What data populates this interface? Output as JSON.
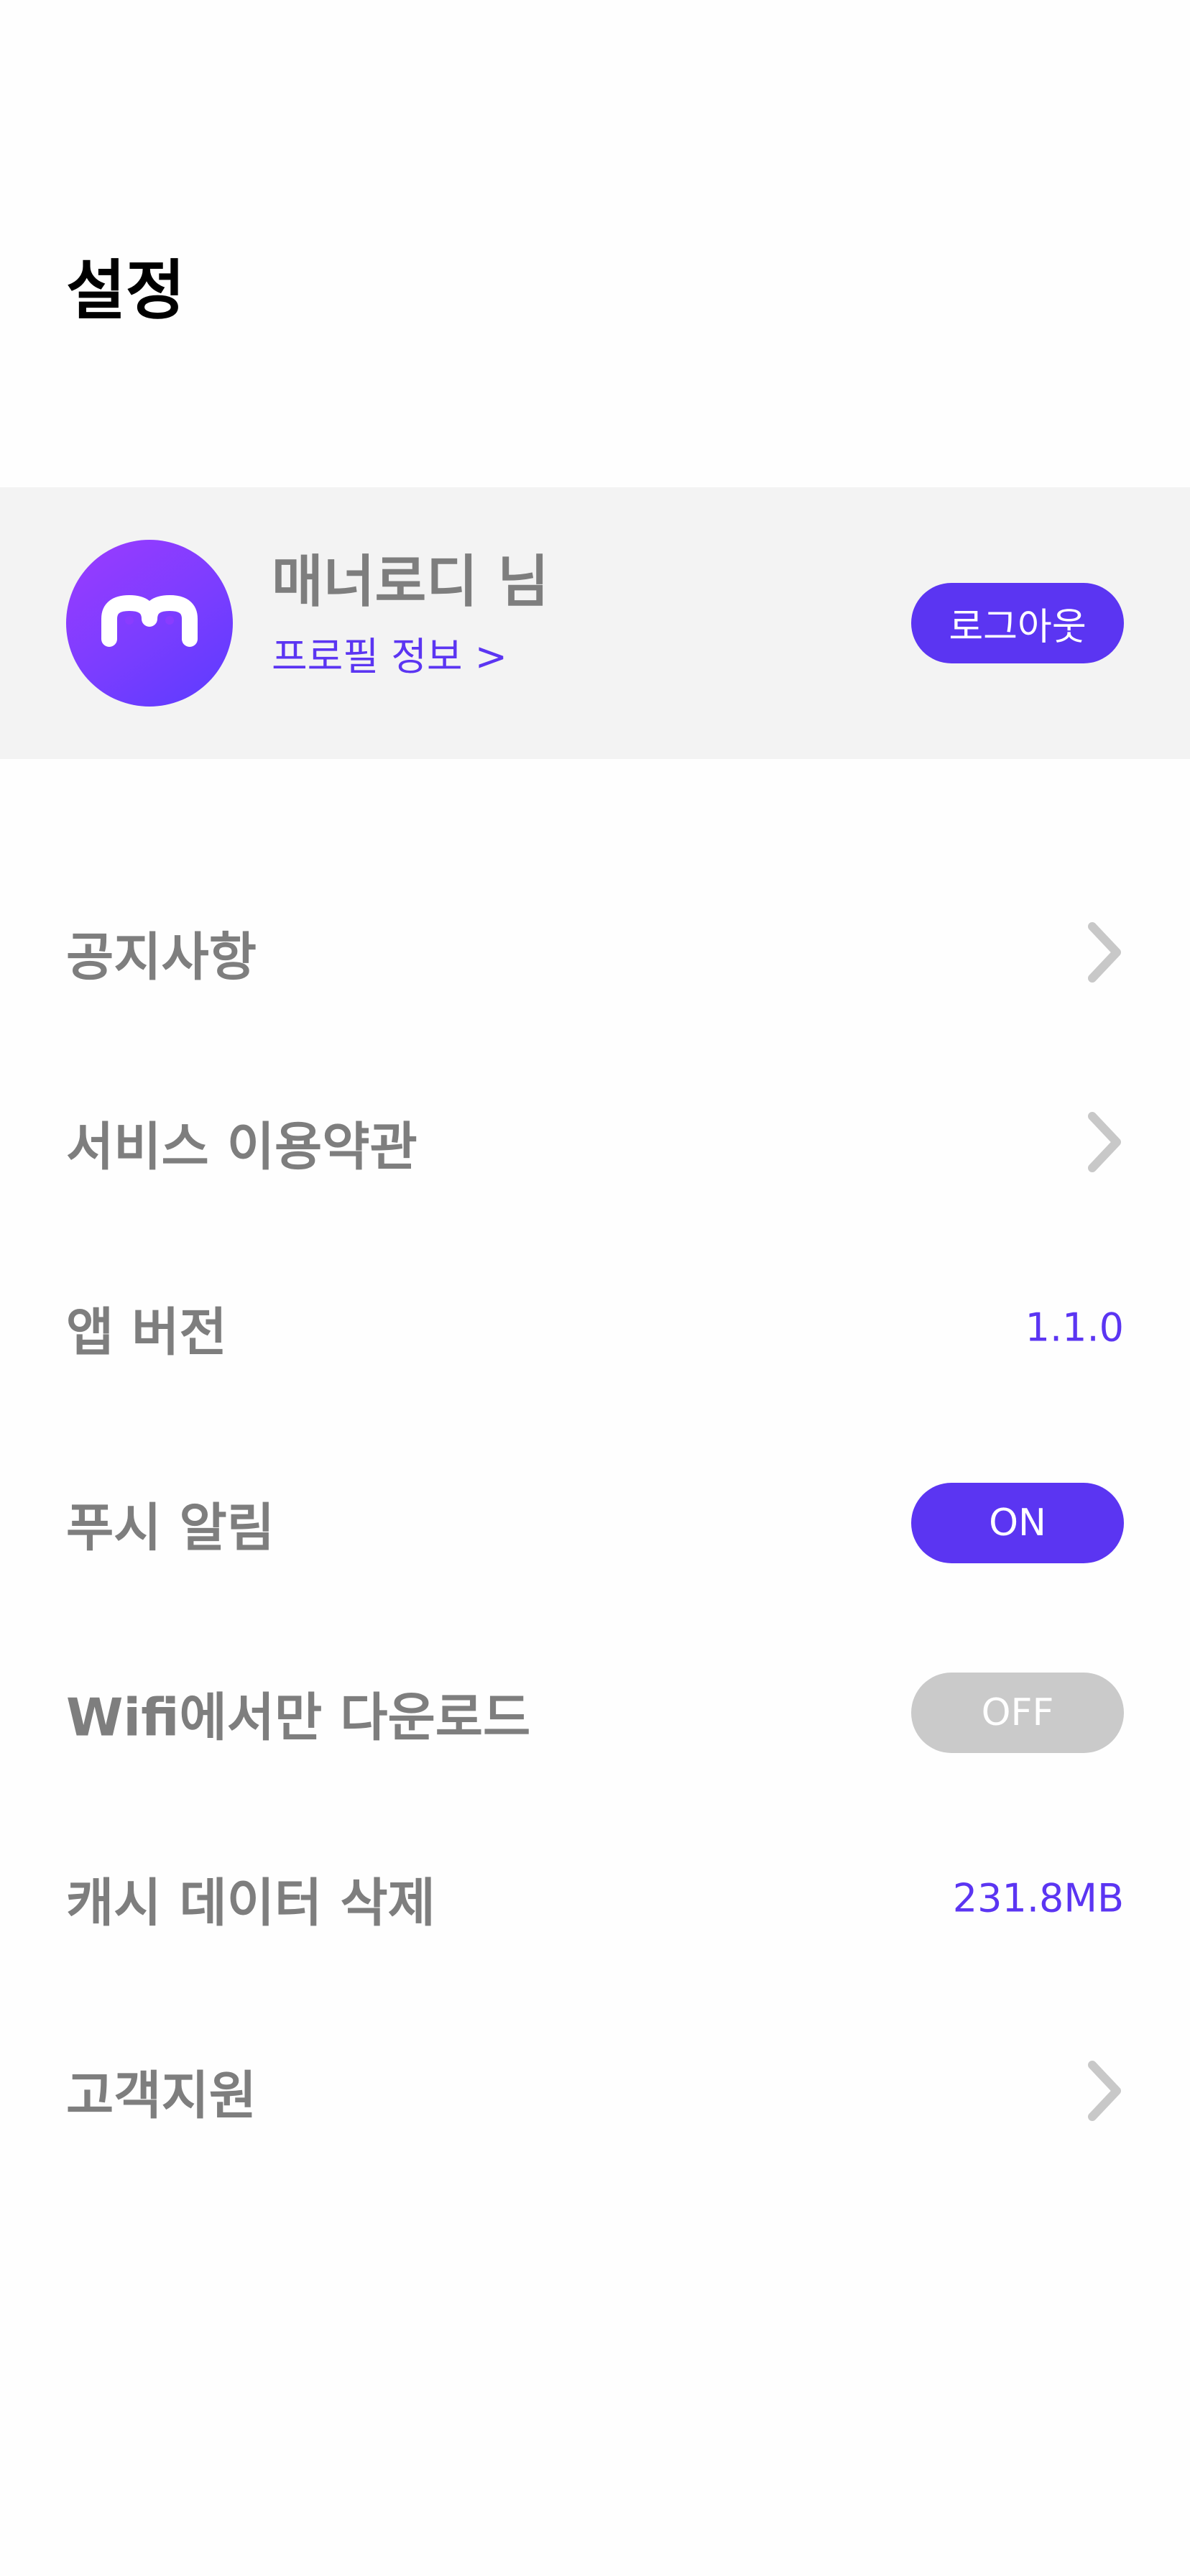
{
  "header": {
    "title": "설정"
  },
  "profile": {
    "name": "매너로디 님",
    "link": "프로필 정보 >",
    "logout_label": "로그아웃"
  },
  "settings": {
    "notice": {
      "label": "공지사항"
    },
    "terms": {
      "label": "서비스 이용약관"
    },
    "app_version": {
      "label": "앱 버전",
      "value": "1.1.0"
    },
    "push": {
      "label": "푸시 알림",
      "toggle": "ON"
    },
    "wifi_only": {
      "label": "Wifi에서만 다운로드",
      "toggle": "OFF"
    },
    "cache": {
      "label": "캐시 데이터 삭제",
      "value": "231.8MB"
    },
    "support": {
      "label": "고객지원"
    }
  },
  "colors": {
    "accent": "#5b35f2",
    "label_gray": "#7e7e7e",
    "toggle_off": "#cacaca",
    "card_bg": "#f3f3f3"
  },
  "icons": {
    "avatar_logo": "m-logo-icon",
    "chevron": "chevron-right-icon"
  }
}
